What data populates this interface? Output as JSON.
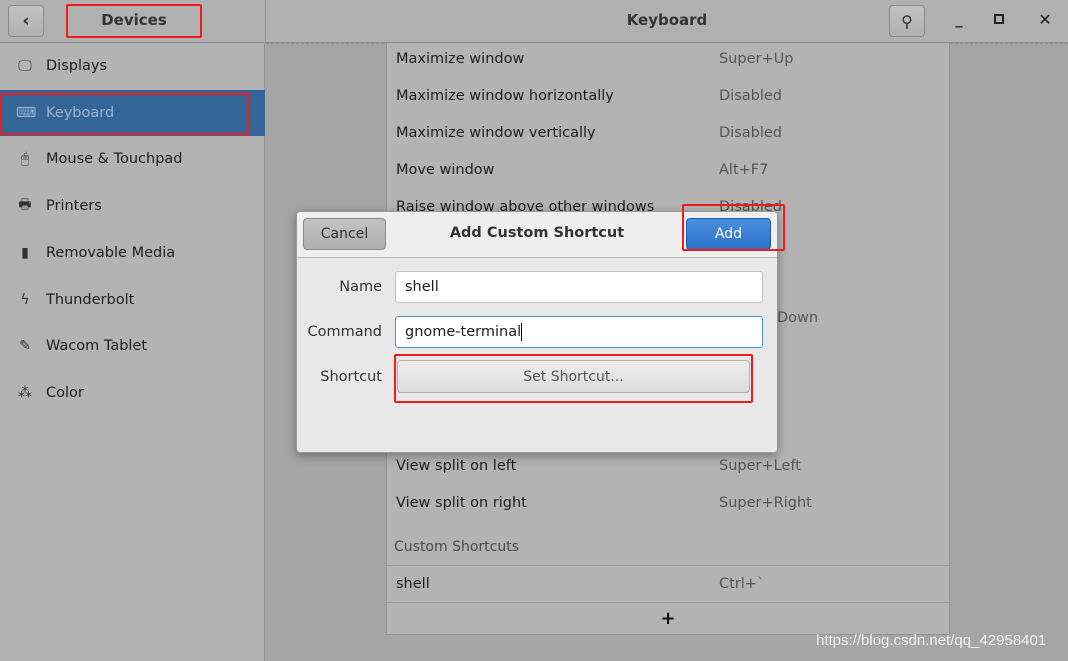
{
  "header": {
    "back_icon": "chevron-left-icon",
    "section_title": "Devices",
    "panel_title": "Keyboard",
    "search_icon": "search-icon",
    "minimize_icon": "minimize-icon",
    "maximize_icon": "maximize-icon",
    "close_icon": "close-icon"
  },
  "sidebar": {
    "selected": "Keyboard",
    "selected_color": "#336598",
    "items": [
      {
        "label": "Displays",
        "icon": "display-icon",
        "glyph": "🖵"
      },
      {
        "label": "Keyboard",
        "icon": "keyboard-icon",
        "glyph": "⌨"
      },
      {
        "label": "Mouse & Touchpad",
        "icon": "mouse-icon",
        "glyph": "🖱"
      },
      {
        "label": "Printers",
        "icon": "printer-icon",
        "glyph": "🖶"
      },
      {
        "label": "Removable Media",
        "icon": "usb-drive-icon",
        "glyph": "▮"
      },
      {
        "label": "Thunderbolt",
        "icon": "thunderbolt-icon",
        "glyph": "ϟ"
      },
      {
        "label": "Wacom Tablet",
        "icon": "tablet-icon",
        "glyph": "✎"
      },
      {
        "label": "Color",
        "icon": "color-icon",
        "glyph": "⁂"
      }
    ]
  },
  "shortcuts": {
    "rows": [
      {
        "action": "Maximize window",
        "keys": "Super+Up"
      },
      {
        "action": "Maximize window horizontally",
        "keys": "Disabled"
      },
      {
        "action": "Maximize window vertically",
        "keys": "Disabled"
      },
      {
        "action": "Move window",
        "keys": "Alt+F7"
      },
      {
        "action": "Raise window above other windows",
        "keys": "Disabled"
      }
    ],
    "partial_keys": "Down",
    "rows_after": [
      {
        "action": "View split on left",
        "keys": "Super+Left"
      },
      {
        "action": "View split on right",
        "keys": "Super+Right"
      }
    ],
    "custom_heading": "Custom Shortcuts",
    "custom": [
      {
        "action": "shell",
        "keys": "Ctrl+`"
      }
    ],
    "add_label": "+"
  },
  "dialog": {
    "title": "Add Custom Shortcut",
    "cancel": "Cancel",
    "add": "Add",
    "add_color": "#2f7bd3",
    "name_label": "Name",
    "name_value": "shell",
    "command_label": "Command",
    "command_value": "gnome-terminal",
    "shortcut_label": "Shortcut",
    "set_shortcut": "Set Shortcut..."
  },
  "watermark": "https://blog.csdn.net/qq_42958401"
}
